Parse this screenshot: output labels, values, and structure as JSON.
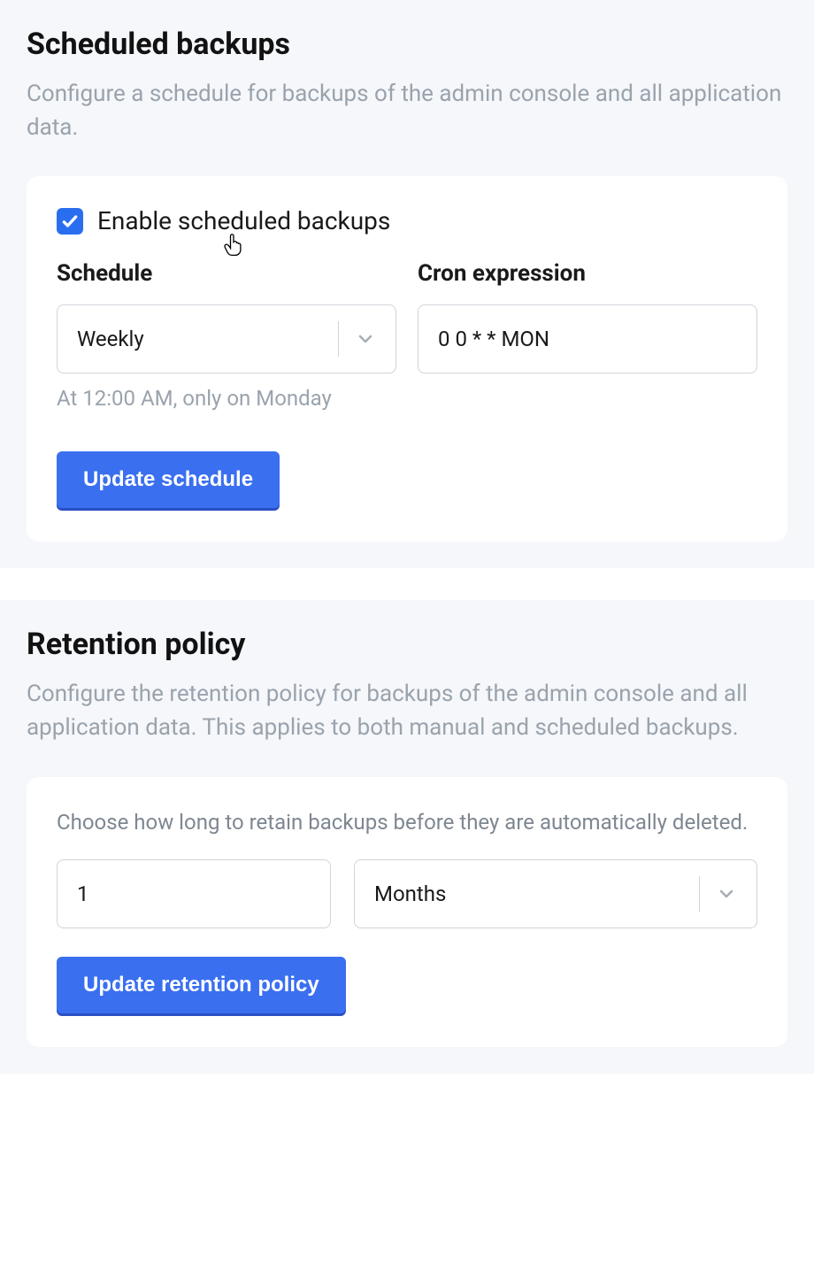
{
  "scheduled": {
    "title": "Scheduled backups",
    "desc": "Configure a schedule for backups of the admin console and all application data.",
    "enable_label": "Enable scheduled backups",
    "enable_checked": true,
    "schedule_label": "Schedule",
    "schedule_value": "Weekly",
    "cron_label": "Cron expression",
    "cron_value": "0 0 * * MON",
    "hint": "At 12:00 AM, only on Monday",
    "button": "Update schedule"
  },
  "retention": {
    "title": "Retention policy",
    "desc": "Configure the retention policy for backups of the admin console and all application data. This applies to both manual and scheduled backups.",
    "inner_desc": "Choose how long to retain backups before they are automatically deleted.",
    "value": "1",
    "unit": "Months",
    "button": "Update retention policy"
  }
}
